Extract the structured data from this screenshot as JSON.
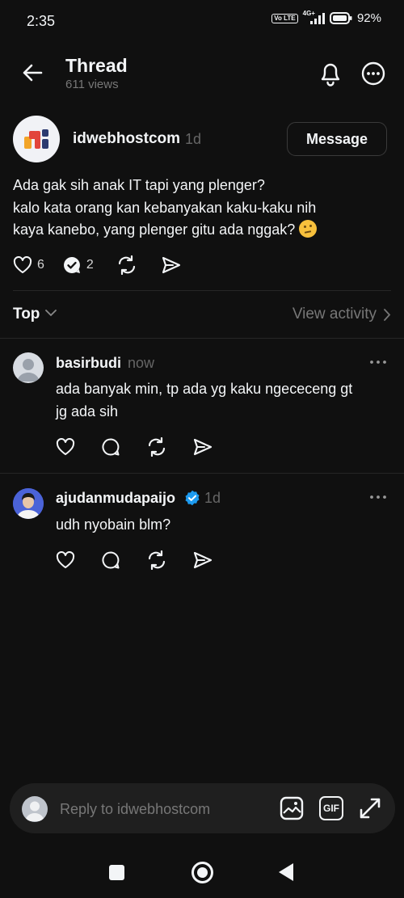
{
  "status_bar": {
    "time": "2:35",
    "volte": "Vo LTE",
    "network": "4G+",
    "battery": "92%"
  },
  "header": {
    "title": "Thread",
    "views": "611 views"
  },
  "post": {
    "author": "idwebhostcom",
    "time": "1d",
    "message_button": "Message",
    "lines": [
      "Ada gak sih anak IT tapi yang plenger?",
      "kalo kata orang kan kebanyakan kaku-kaku nih",
      "kaya kanebo, yang plenger gitu ada nggak?"
    ],
    "emoji": "thinking-face",
    "likes": "6",
    "replies": "2"
  },
  "sort": {
    "label": "Top",
    "view_activity": "View activity"
  },
  "replies": [
    {
      "author": "basirbudi",
      "time": "now",
      "lines": [
        "ada banyak min, tp ada yg kaku ngececeng  gt",
        "jg ada sih"
      ],
      "verified": false
    },
    {
      "author": "ajudanmudapaijo",
      "time": "1d",
      "lines": [
        "udh nyobain blm?"
      ],
      "verified": true
    }
  ],
  "reply_bar": {
    "placeholder": "Reply to idwebhostcom",
    "gif_label": "GIF"
  },
  "colors": {
    "background": "#101010",
    "text": "#f3f5f7",
    "muted": "#777777",
    "verified": "#1d9bf0"
  }
}
